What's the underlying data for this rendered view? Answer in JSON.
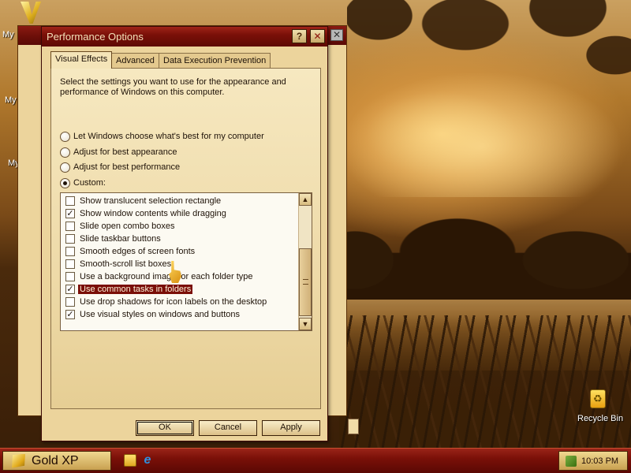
{
  "desktop": {
    "labels": {
      "my1": "My",
      "my2": "My",
      "my3": "My"
    },
    "recycle_bin_label": "Recycle Bin"
  },
  "dialog": {
    "title": "Performance Options",
    "title_buttons": {
      "help": "?",
      "close": "✕"
    },
    "tabs": [
      {
        "label": "Visual Effects",
        "active": true
      },
      {
        "label": "Advanced",
        "active": false
      },
      {
        "label": "Data Execution Prevention",
        "active": false
      }
    ],
    "intro": "Select the settings you want to use for the appearance and performance of Windows on this computer.",
    "radios": [
      {
        "label": "Let Windows choose what's best for my computer",
        "checked": false
      },
      {
        "label": "Adjust for best appearance",
        "checked": false
      },
      {
        "label": "Adjust for best performance",
        "checked": false
      },
      {
        "label": "Custom:",
        "checked": true
      }
    ],
    "effects": [
      {
        "label": "Show translucent selection rectangle",
        "checked": false,
        "selected": false
      },
      {
        "label": "Show window contents while dragging",
        "checked": true,
        "selected": false
      },
      {
        "label": "Slide open combo boxes",
        "checked": false,
        "selected": false
      },
      {
        "label": "Slide taskbar buttons",
        "checked": false,
        "selected": false
      },
      {
        "label": "Smooth edges of screen fonts",
        "checked": false,
        "selected": false
      },
      {
        "label": "Smooth-scroll list boxes",
        "checked": false,
        "selected": false
      },
      {
        "label": "Use a background image for each folder type",
        "checked": false,
        "selected": false
      },
      {
        "label": "Use common tasks in folders",
        "checked": true,
        "selected": true
      },
      {
        "label": "Use drop shadows for icon labels on the desktop",
        "checked": false,
        "selected": false
      },
      {
        "label": "Use visual styles on windows and buttons",
        "checked": true,
        "selected": false
      }
    ],
    "scroll_arrows": {
      "up": "▲",
      "down": "▼"
    },
    "buttons": {
      "ok": "OK",
      "cancel": "Cancel",
      "apply": "Apply"
    }
  },
  "taskbar": {
    "start_label": "Gold XP",
    "ie_glyph": "e",
    "clock": "10:03 PM"
  },
  "colors": {
    "title_bar": "#7a1008",
    "selection": "#7a0e08",
    "dialog_bg": "#ecd49c"
  }
}
